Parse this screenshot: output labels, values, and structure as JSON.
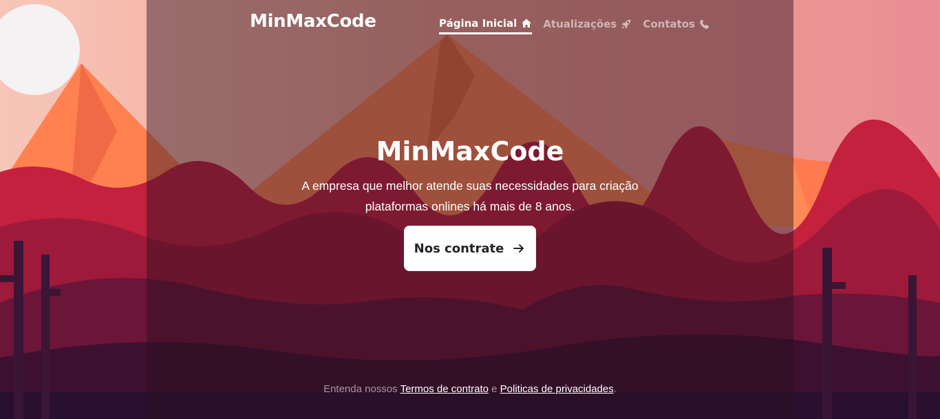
{
  "header": {
    "brand": "MinMaxCode",
    "nav": [
      {
        "label": "Página Inicial",
        "icon": "home-icon",
        "active": true
      },
      {
        "label": "Atualizações",
        "icon": "rocket-icon",
        "active": false
      },
      {
        "label": "Contatos",
        "icon": "phone-icon",
        "active": false
      }
    ]
  },
  "hero": {
    "title": "MinMaxCode",
    "subtitle": "A empresa que melhor atende suas necessidades para criação plataformas onlines há mais de 8 anos.",
    "cta_label": "Nos contrate",
    "cta_icon": "arrow-right-icon"
  },
  "footer": {
    "prefix": "Entenda nossos ",
    "terms_link": "Termos de contrato",
    "conjunction": " e ",
    "privacy_link": "Politicas de privacidades",
    "suffix": "."
  },
  "colors": {
    "sky_top": "#f6b9a9",
    "mountain": "#ff7f4f",
    "foliage_red": "#c9243f",
    "foliage_dark": "#5b1236",
    "foreground": "#2a1030",
    "sun": "#f2f2f2",
    "button_bg": "#ffffff",
    "button_text": "#212529"
  }
}
